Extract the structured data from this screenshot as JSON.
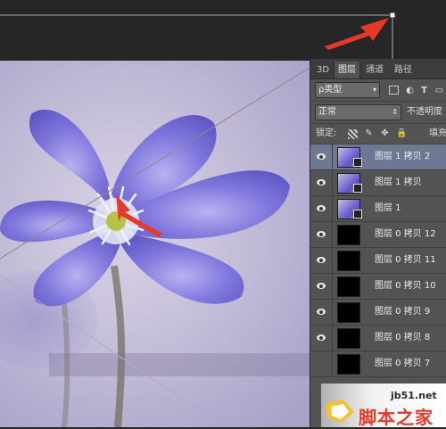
{
  "panel": {
    "tabs": [
      {
        "label": "3D",
        "active": false
      },
      {
        "label": "图层",
        "active": true
      },
      {
        "label": "通道",
        "active": false
      },
      {
        "label": "路径",
        "active": false
      }
    ],
    "filter": {
      "kind_label": "ρ类型",
      "icon": "search-icon"
    },
    "blend_mode": {
      "value": "正常",
      "opacity_label": "不透明度"
    },
    "lock": {
      "label": "锁定:",
      "fill_label": "填充"
    },
    "layers": [
      {
        "name": "图层 1 拷贝 2",
        "thumb": "flower",
        "selected": true,
        "visible": true
      },
      {
        "name": "图层 1 拷贝",
        "thumb": "flower",
        "selected": false,
        "visible": true
      },
      {
        "name": "图层 1",
        "thumb": "flower",
        "selected": false,
        "visible": true
      },
      {
        "name": "图层 0 拷贝 12",
        "thumb": "black",
        "selected": false,
        "visible": true
      },
      {
        "name": "图层 0 拷贝 11",
        "thumb": "black",
        "selected": false,
        "visible": true
      },
      {
        "name": "图层 0 拷贝 10",
        "thumb": "black",
        "selected": false,
        "visible": true
      },
      {
        "name": "图层 0 拷贝 9",
        "thumb": "black",
        "selected": false,
        "visible": true
      },
      {
        "name": "图层 0 拷贝 8",
        "thumb": "black",
        "selected": false,
        "visible": true
      },
      {
        "name": "图层 0 拷贝 7",
        "thumb": "black",
        "selected": false,
        "visible": false
      }
    ]
  },
  "watermark": {
    "url": "jb51.net",
    "site": "脚本之家"
  },
  "colors": {
    "selected_layer": "#6d7993",
    "panel_bg": "#535353",
    "arrow": "#e8372b",
    "petal": "#7b72d8"
  }
}
